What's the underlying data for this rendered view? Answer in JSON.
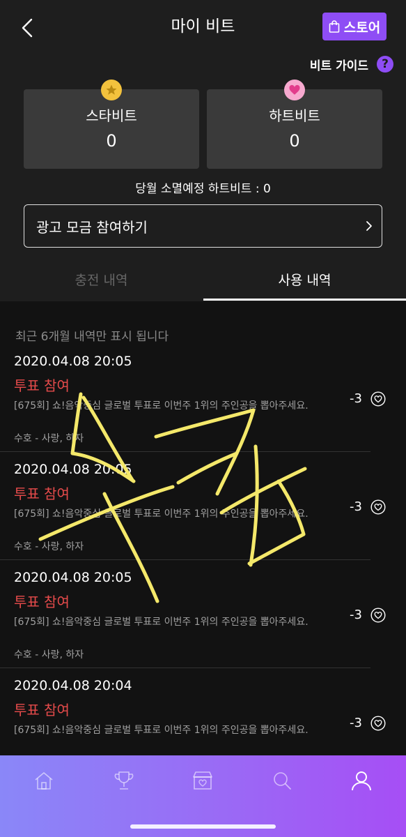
{
  "header": {
    "title": "마이 비트",
    "store_label": "스토어",
    "guide_label": "비트 가이드",
    "help_symbol": "?"
  },
  "balances": [
    {
      "label": "스타비트",
      "value": "0",
      "icon": "star-icon",
      "color": "#f3c23d"
    },
    {
      "label": "하트비트",
      "value": "0",
      "icon": "heart-icon",
      "color": "#f27ab8"
    }
  ],
  "expire_text": "당월 소멸예정 하트비트 : 0",
  "ad_button_label": "광고 모금 참여하기",
  "tabs": [
    {
      "label": "충전 내역",
      "active": false
    },
    {
      "label": "사용 내역",
      "active": true
    }
  ],
  "notice": "최근 6개월 내역만 표시 됩니다",
  "history": [
    {
      "date": "2020.04.08 20:05",
      "type": "투표 참여",
      "description": "[675회] 쇼!음악중심 글로벌 투표로 이번주 1위의 주인공을 뽑아주세요.",
      "detail": "수호 - 사랑, 하자",
      "amount": "-3"
    },
    {
      "date": "2020.04.08 20:05",
      "type": "투표 참여",
      "description": "[675회] 쇼!음악중심 글로벌 투표로 이번주 1위의 주인공을 뽑아주세요.",
      "detail": "수호 - 사랑, 하자",
      "amount": "-3"
    },
    {
      "date": "2020.04.08 20:05",
      "type": "투표 참여",
      "description": "[675회] 쇼!음악중심 글로벌 투표로 이번주 1위의 주인공을 뽑아주세요.",
      "detail": "수호 - 사랑, 하자",
      "amount": "-3"
    },
    {
      "date": "2020.04.08 20:04",
      "type": "투표 참여",
      "description": "[675회] 쇼!음악중심 글로벌 투표로 이번주 1위의 주인공을 뽑아주세요.",
      "detail": "",
      "amount": "-3"
    }
  ],
  "bottom_nav": [
    "home-icon",
    "trophy-icon",
    "box-icon",
    "search-icon",
    "profile-icon"
  ],
  "colors": {
    "accent": "#8e4df5",
    "vote_red": "#e64b4b",
    "handwriting": "#f4e86a"
  }
}
